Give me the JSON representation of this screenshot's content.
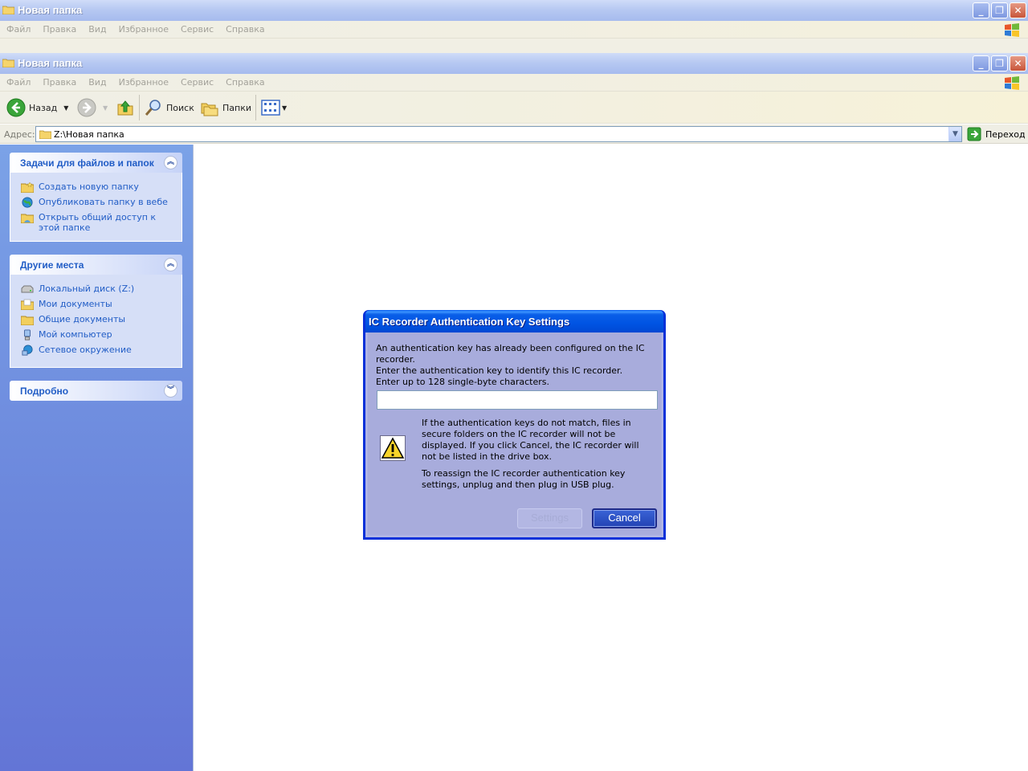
{
  "back_window": {
    "title": "Новая папка",
    "menu": [
      "Файл",
      "Правка",
      "Вид",
      "Избранное",
      "Сервис",
      "Справка"
    ]
  },
  "window": {
    "title": "Новая папка",
    "menu": [
      "Файл",
      "Правка",
      "Вид",
      "Избранное",
      "Сервис",
      "Справка"
    ],
    "toolbar": {
      "back_label": "Назад",
      "search_label": "Поиск",
      "folders_label": "Папки"
    },
    "address": {
      "label": "Адрес:",
      "value": "Z:\\Новая папка",
      "go_label": "Переход"
    }
  },
  "sidebar": {
    "tasks": {
      "title": "Задачи для файлов и папок",
      "items": [
        {
          "label": "Создать новую папку",
          "icon": "new-folder-icon"
        },
        {
          "label": "Опубликовать папку в вебе",
          "icon": "publish-web-icon"
        },
        {
          "label": "Открыть общий доступ к этой папке",
          "icon": "share-folder-icon"
        }
      ]
    },
    "other_places": {
      "title": "Другие места",
      "items": [
        {
          "label": "Локальный диск (Z:)",
          "icon": "drive-icon"
        },
        {
          "label": "Мои документы",
          "icon": "my-documents-icon"
        },
        {
          "label": "Общие документы",
          "icon": "shared-documents-icon"
        },
        {
          "label": "Мой компьютер",
          "icon": "my-computer-icon"
        },
        {
          "label": "Сетевое окружение",
          "icon": "network-icon"
        }
      ]
    },
    "details": {
      "title": "Подробно"
    }
  },
  "dialog": {
    "title": "IC Recorder Authentication Key Settings",
    "message_lines": [
      "An authentication key has already been configured on the IC recorder.",
      "Enter the authentication key to identify this IC recorder.",
      "Enter up to 128 single-byte characters."
    ],
    "key_value": "",
    "warning_1": "If the authentication keys do not match, files in secure folders on the IC recorder will not be displayed.  If you click Cancel, the IC recorder will not be listed in the drive box.",
    "warning_2": "To reassign the IC recorder authentication key settings, unplug and then plug in USB plug.",
    "settings_label": "Settings",
    "cancel_label": "Cancel"
  }
}
